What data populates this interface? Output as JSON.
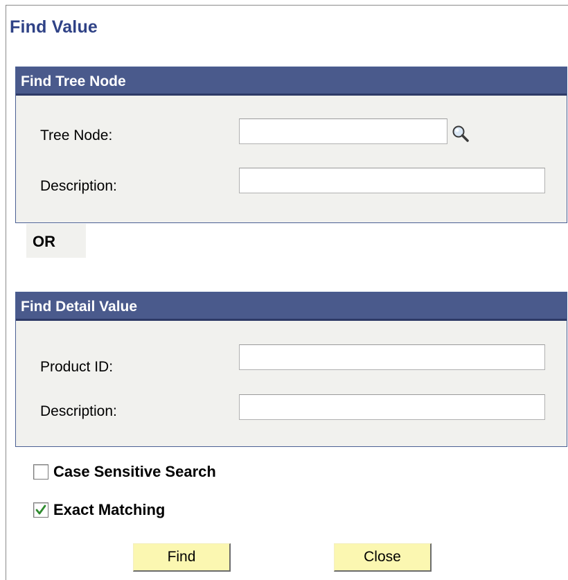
{
  "page": {
    "title": "Find Value"
  },
  "find_tree_node": {
    "header": "Find Tree Node",
    "tree_node_label": "Tree Node:",
    "tree_node_value": "",
    "description_label": "Description:",
    "description_value": ""
  },
  "separator": {
    "or_label": "OR"
  },
  "find_detail_value": {
    "header": "Find Detail Value",
    "product_id_label": "Product ID:",
    "product_id_value": "",
    "description_label": "Description:",
    "description_value": ""
  },
  "options": {
    "case_sensitive_label": "Case Sensitive Search",
    "case_sensitive_checked": false,
    "exact_matching_label": "Exact Matching",
    "exact_matching_checked": true
  },
  "buttons": {
    "find_label": "Find",
    "close_label": "Close"
  },
  "icons": {
    "lookup": "magnifier-lookup-icon",
    "checkmark": "checkmark-icon"
  },
  "colors": {
    "title": "#2f4286",
    "group_header": "#4a5a8c",
    "group_body": "#f1f1ee",
    "button": "#fbf7b1",
    "checkmark": "#2e8b2e"
  }
}
